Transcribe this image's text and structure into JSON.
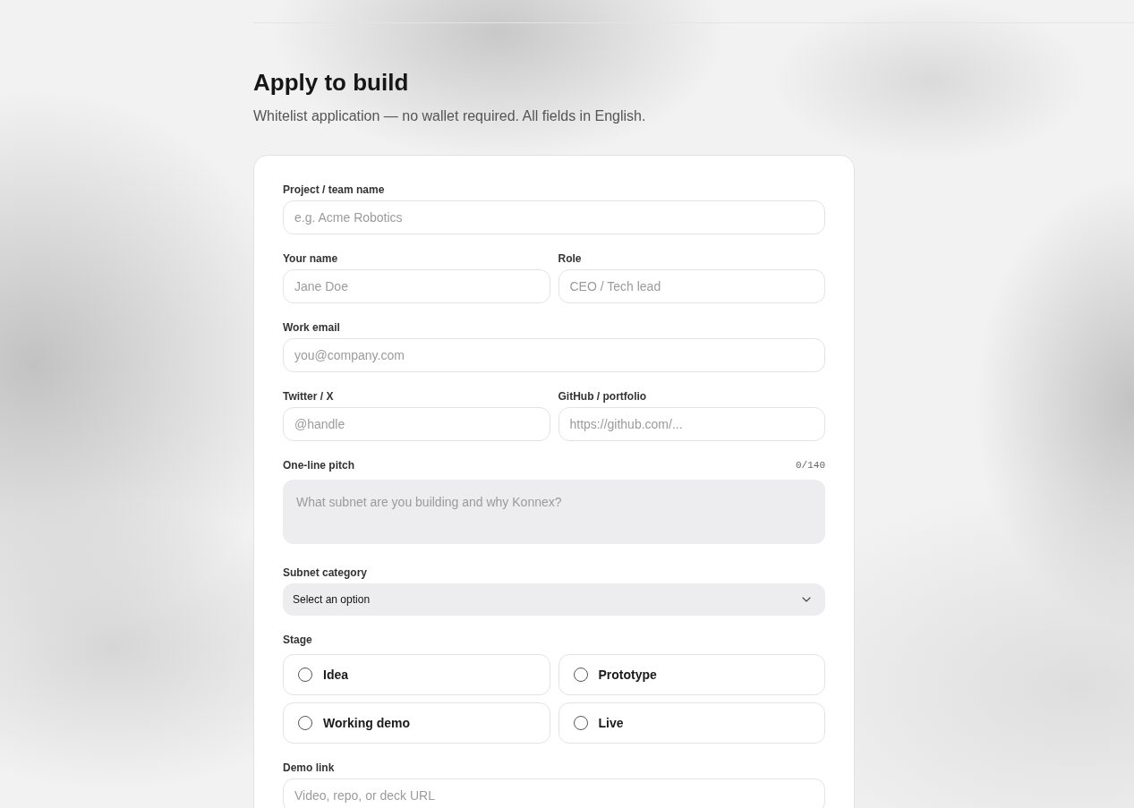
{
  "header": {
    "title": "Apply to build",
    "subtitle": "Whitelist application — no wallet required. All fields in English."
  },
  "form": {
    "rows": [
      [
        {
          "kind": "input",
          "label": "Project / team name",
          "placeholder": "e.g. Acme Robotics"
        }
      ],
      [
        {
          "kind": "input",
          "label": "Your name",
          "placeholder": "Jane Doe"
        },
        {
          "kind": "input",
          "label": "Role",
          "placeholder": "CEO / Tech lead"
        }
      ],
      [
        {
          "kind": "input",
          "label": "Work email",
          "placeholder": "you@company.com"
        }
      ],
      [
        {
          "kind": "input",
          "label": "Twitter / X",
          "placeholder": "@handle"
        },
        {
          "kind": "input",
          "label": "GitHub / portfolio",
          "placeholder": "https://github.com/..."
        }
      ],
      [
        {
          "kind": "textarea",
          "label": "One-line pitch",
          "counter": "0/140",
          "placeholder": "What subnet are you building and why Konnex?"
        }
      ],
      [
        {
          "kind": "select",
          "label": "Subnet category",
          "value": "Select an option"
        }
      ],
      [
        {
          "kind": "radio",
          "label": "Stage",
          "options": [
            {
              "label": "Idea",
              "selected": false
            },
            {
              "label": "Prototype",
              "selected": false
            },
            {
              "label": "Working demo",
              "selected": false
            },
            {
              "label": "Live",
              "selected": false
            }
          ]
        }
      ],
      [
        {
          "kind": "input",
          "label": "Demo link",
          "placeholder": "Video, repo, or deck URL"
        }
      ]
    ]
  }
}
